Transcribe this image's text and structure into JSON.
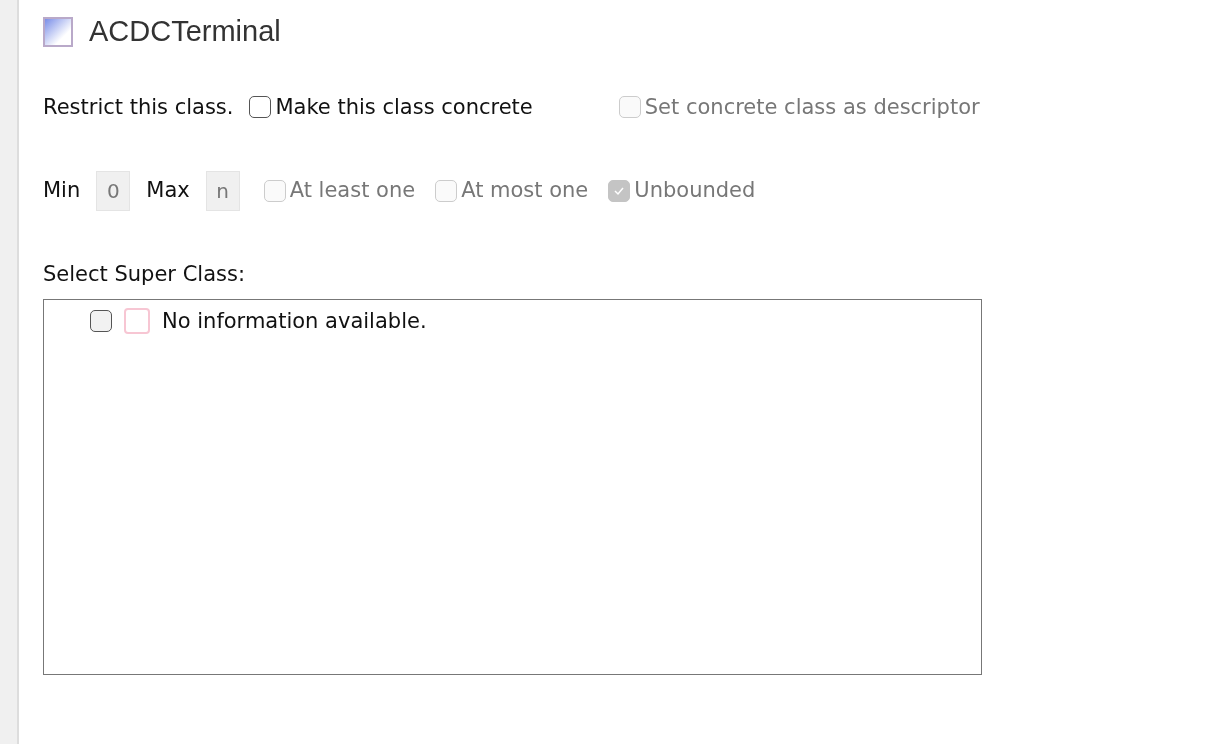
{
  "header": {
    "title": "ACDCTerminal"
  },
  "restrict": {
    "label": "Restrict this class.",
    "options": [
      {
        "label": "Make this class concrete",
        "checked": false,
        "disabled": false
      },
      {
        "label": "Set concrete class as descriptor",
        "checked": false,
        "disabled": true
      }
    ]
  },
  "cardinality": {
    "min_label": "Min",
    "min_value": "0",
    "max_label": "Max",
    "max_value": "n",
    "options": [
      {
        "label": "At least one",
        "checked": false,
        "disabled": true
      },
      {
        "label": "At most one",
        "checked": false,
        "disabled": true
      },
      {
        "label": "Unbounded",
        "checked": true,
        "disabled": true
      }
    ]
  },
  "super_class": {
    "label": "Select Super Class:",
    "items": [
      {
        "label": "No information available.",
        "checked": false
      }
    ]
  }
}
